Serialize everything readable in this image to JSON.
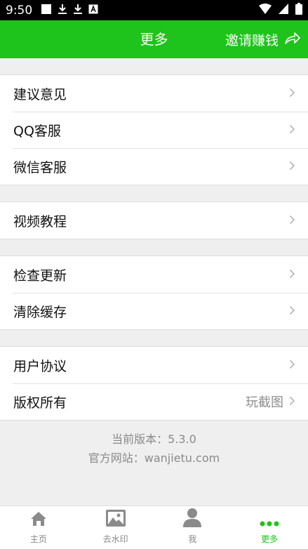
{
  "status_bar": {
    "time": "9:50"
  },
  "header": {
    "title": "更多",
    "invite_label": "邀请赚钱"
  },
  "menu_groups": [
    {
      "items": [
        {
          "label": "建议意见"
        },
        {
          "label": "QQ客服"
        },
        {
          "label": "微信客服"
        }
      ]
    },
    {
      "items": [
        {
          "label": "视频教程"
        }
      ]
    },
    {
      "items": [
        {
          "label": "检查更新"
        },
        {
          "label": "清除缓存"
        }
      ]
    },
    {
      "items": [
        {
          "label": "用户协议"
        },
        {
          "label": "版权所有",
          "value": "玩截图"
        }
      ]
    }
  ],
  "footer": {
    "version_line": "当前版本：5.3.0",
    "website_line": "官方网站：wanjietu.com"
  },
  "tabs": [
    {
      "label": "主页",
      "icon": "home-icon",
      "active": false
    },
    {
      "label": "去水印",
      "icon": "image-icon",
      "active": false
    },
    {
      "label": "我",
      "icon": "person-icon",
      "active": false
    },
    {
      "label": "更多",
      "icon": "more-dots-icon",
      "active": true
    }
  ],
  "colors": {
    "accent": "#1ec41b",
    "status_bar": "#000000",
    "background": "#efefef"
  }
}
